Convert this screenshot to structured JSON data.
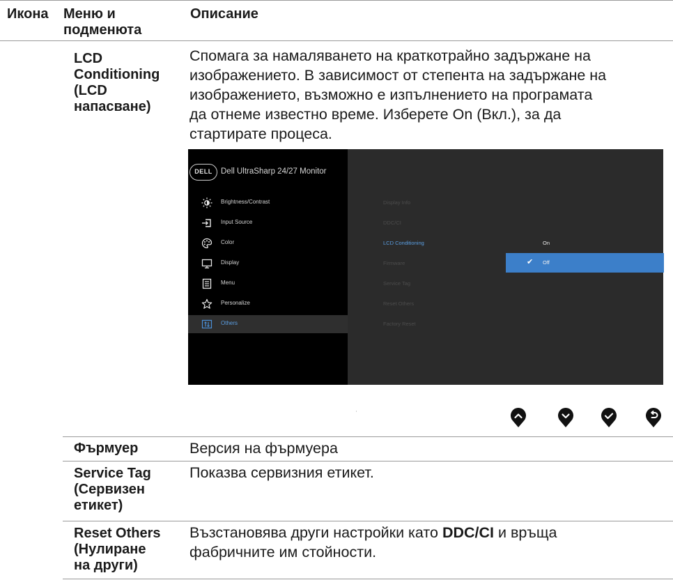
{
  "table": {
    "headers": {
      "icon": "Икона",
      "menu": "Меню и подменюта",
      "description": "Описание"
    },
    "rows": {
      "lcd": {
        "name_lines": [
          "LCD",
          "Conditioning",
          "(LCD",
          "напасване)"
        ],
        "desc_lines": [
          "Спомага за намаляването на краткотрайно задържане на",
          "изображението. В зависимост от степента на задържане на",
          "изображението, възможно е изпълнението на програмата",
          "да отнеме известно време. Изберете On (Вкл.), за да",
          "стартирате процеса."
        ]
      },
      "firmware": {
        "name": "Фърмуер",
        "desc": "Версия на фърмуера"
      },
      "service_tag": {
        "name_lines": [
          "Service Tag",
          "(Сервизен",
          "етикет)"
        ],
        "desc": "Показва сервизния етикет."
      },
      "reset_others": {
        "name_lines": [
          "Reset Others",
          "(Нулиране",
          "на други)"
        ],
        "desc_prefix": "Възстановява други настройки като",
        "desc_bold": "DDC/CI",
        "desc_suffix": "и връща",
        "desc_line2": "фабричните им стойности."
      }
    }
  },
  "osd": {
    "logo": "DELL",
    "title": "Dell UltraSharp 24/27 Monitor",
    "menu": [
      {
        "label": "Brightness/Contrast",
        "icon": "brightness-icon"
      },
      {
        "label": "Input Source",
        "icon": "input-source-icon"
      },
      {
        "label": "Color",
        "icon": "color-palette-icon"
      },
      {
        "label": "Display",
        "icon": "display-monitor-icon"
      },
      {
        "label": "Menu",
        "icon": "menu-list-icon"
      },
      {
        "label": "Personalize",
        "icon": "star-icon"
      },
      {
        "label": "Others",
        "icon": "others-icon"
      }
    ],
    "active_menu": "Others",
    "submenu": [
      "Display Info",
      "DDC/CI",
      "LCD Conditioning",
      "Firmware",
      "Service Tag",
      "Reset Others",
      "Factory Reset"
    ],
    "active_submenu": "LCD Conditioning",
    "options": [
      "On",
      "Off"
    ],
    "selected_option": "Off",
    "colors": {
      "accent": "#3c7fc9",
      "active_text": "#5b9fe3",
      "panel": "#2b2b2b",
      "sidebar": "#000000"
    }
  },
  "nav_buttons": [
    "up-button-icon",
    "down-button-icon",
    "check-button-icon",
    "back-button-icon"
  ]
}
